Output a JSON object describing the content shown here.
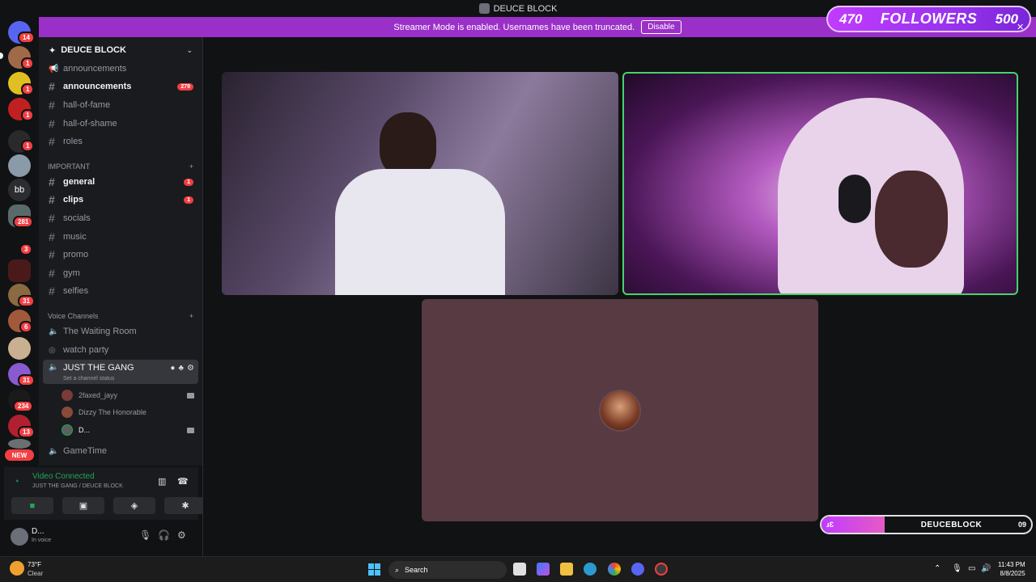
{
  "window": {
    "title": "DEUCE BLOCK"
  },
  "banner": {
    "text": "Streamer Mode is enabled. Usernames have been truncated.",
    "disable_label": "Disable"
  },
  "overlay": {
    "current": "470",
    "label": "FOLLOWERS",
    "goal": "500",
    "goal_progress": 0.94
  },
  "guild_badges": [
    "14",
    "1",
    "1",
    "1",
    "1",
    "281",
    "3",
    "31",
    "6",
    "31",
    "234",
    "13"
  ],
  "guild_labels": {
    "bb": "bb",
    "new": "NEW"
  },
  "server": {
    "name": "DEUCE BLOCK"
  },
  "channels": {
    "top": [
      {
        "name": "announcements",
        "icon": "megaphone-icon"
      },
      {
        "name": "announcements",
        "unread": true,
        "count": "279"
      },
      {
        "name": "hall-of-fame"
      },
      {
        "name": "hall-of-shame"
      },
      {
        "name": "roles"
      }
    ],
    "important_label": "IMPORTANT",
    "important": [
      {
        "name": "general",
        "unread": true,
        "count": "1"
      },
      {
        "name": "clips",
        "unread": true,
        "count": "1"
      },
      {
        "name": "socials"
      },
      {
        "name": "music"
      },
      {
        "name": "promo"
      },
      {
        "name": "gym"
      },
      {
        "name": "selfies"
      }
    ],
    "voice_label": "Voice Channels",
    "voice": [
      {
        "name": "The Waiting Room"
      },
      {
        "name": "watch party"
      },
      {
        "name": "JUST THE GANG",
        "status": "Set a channel status"
      },
      {
        "name": "GameTime"
      }
    ],
    "members": [
      {
        "name": "2faxed_jayy"
      },
      {
        "name": "Dizzy The Honorable"
      },
      {
        "name": "D..."
      }
    ]
  },
  "voice_panel": {
    "status": "Video Connected",
    "location": "JUST THE GANG / DEUCE BLOCK"
  },
  "user": {
    "name": "D...",
    "status": "In voice"
  },
  "stream_namebar": {
    "left": "ɹƐ",
    "name": "DEUCEBLOCK",
    "right": "09"
  },
  "taskbar": {
    "weather_temp": "73°F",
    "weather_desc": "Clear",
    "search_placeholder": "Search",
    "time": "11:43 PM",
    "date": "8/8/2025"
  }
}
